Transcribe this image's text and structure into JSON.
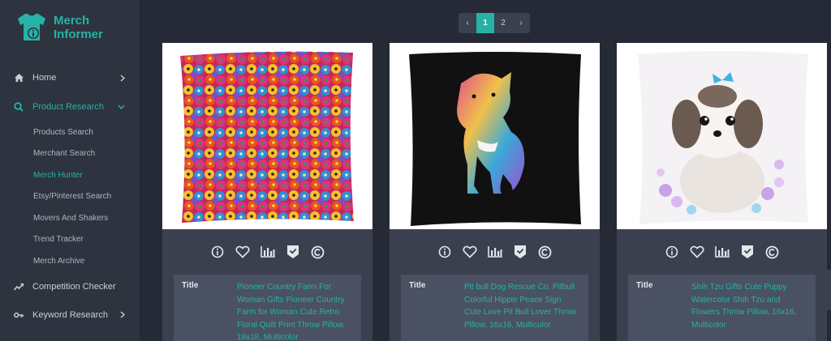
{
  "brand": {
    "line1": "Merch",
    "line2": "Informer"
  },
  "sidebar": {
    "items": [
      {
        "label": "Home",
        "icon": "home-icon"
      },
      {
        "label": "Product Research",
        "icon": "search-icon"
      },
      {
        "label": "Competition Checker",
        "icon": "chart-line-icon"
      },
      {
        "label": "Keyword Research",
        "icon": "key-icon"
      }
    ],
    "sub_items": [
      {
        "label": "Products Search"
      },
      {
        "label": "Merchant Search"
      },
      {
        "label": "Merch Hunter"
      },
      {
        "label": "Etsy/Pinterest Search"
      },
      {
        "label": "Movers And Shakers"
      },
      {
        "label": "Trend Tracker"
      },
      {
        "label": "Merch Archive"
      }
    ]
  },
  "pagination": {
    "prev": "‹",
    "pages": [
      "1",
      "2"
    ],
    "current": "1",
    "next": "›"
  },
  "cards": [
    {
      "title_label": "Title",
      "title": "Pioneer Country Farm For Woman Gifts Pioneer Country Farm for Woman Cute Retro Floral Quilt Print Throw Pillow, 18x18, Multicolor"
    },
    {
      "title_label": "Title",
      "title": "Pit bull Dog Rescue Co. Pitbull Colorful Hippie Peace Sign Cute Love Pit Bull Lover Throw Pillow, 16x16, Multicolor"
    },
    {
      "title_label": "Title",
      "title": "Shih Tzu Gifts Cute Puppy Watercolor Shih Tzu and Flowers Throw Pillow, 16x16, Multicolor"
    }
  ],
  "colors": {
    "accent": "#26b3a5",
    "sidebar_bg": "#2e3340",
    "page_bg": "#262a36",
    "card_bg": "#3a404e"
  }
}
